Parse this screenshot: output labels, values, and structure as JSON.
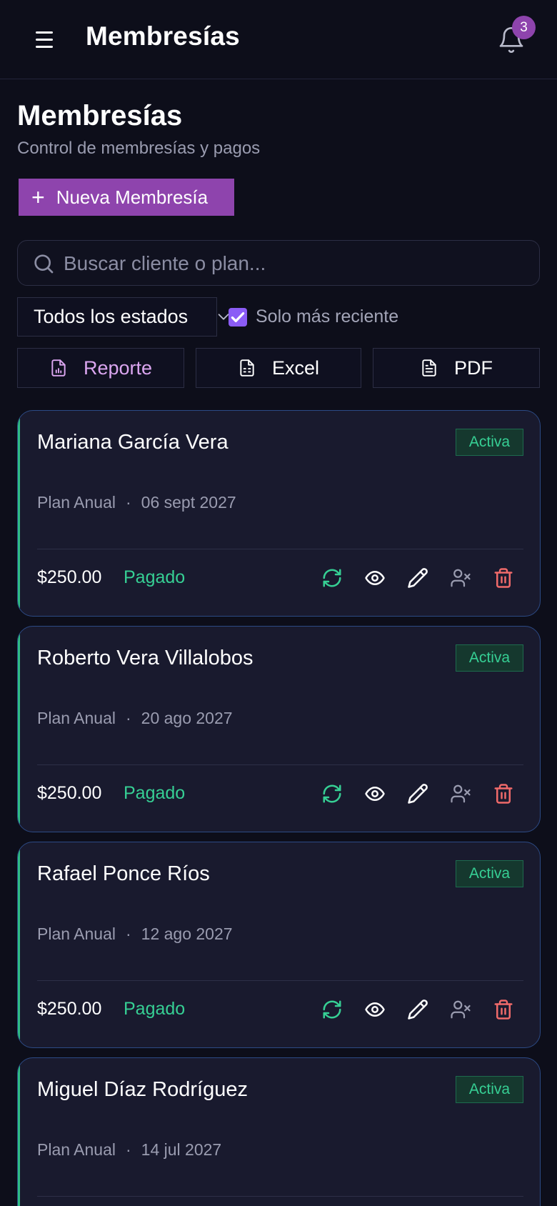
{
  "header": {
    "title": "Membresías",
    "notification_count": "3"
  },
  "page": {
    "title": "Membresías",
    "subtitle": "Control de membresías y pagos",
    "new_button_label": "Nueva Membresía"
  },
  "search": {
    "placeholder": "Buscar cliente o plan...",
    "value": ""
  },
  "filters": {
    "status_selected": "Todos los estados",
    "recent_only_label": "Solo más reciente",
    "recent_only_checked": true
  },
  "exports": {
    "report_label": "Reporte",
    "excel_label": "Excel",
    "pdf_label": "PDF"
  },
  "colors": {
    "accent": "#8e44ad",
    "active_green": "#36cf94",
    "danger_red": "#f06a6a",
    "card_border": "#2c4a85"
  },
  "memberships": [
    {
      "name": "Mariana García Vera",
      "status": "Activa",
      "plan": "Plan Anual",
      "date": "06 sept 2027",
      "price": "$250.00",
      "payment": "Pagado"
    },
    {
      "name": "Roberto Vera Villalobos",
      "status": "Activa",
      "plan": "Plan Anual",
      "date": "20 ago 2027",
      "price": "$250.00",
      "payment": "Pagado"
    },
    {
      "name": "Rafael Ponce Ríos",
      "status": "Activa",
      "plan": "Plan Anual",
      "date": "12 ago 2027",
      "price": "$250.00",
      "payment": "Pagado"
    },
    {
      "name": "Miguel Díaz Rodríguez",
      "status": "Activa",
      "plan": "Plan Anual",
      "date": "14 jul 2027",
      "price": "",
      "payment": ""
    }
  ],
  "action_icons": [
    "renew-icon",
    "eye-icon",
    "pencil-icon",
    "user-x-icon",
    "trash-icon"
  ]
}
